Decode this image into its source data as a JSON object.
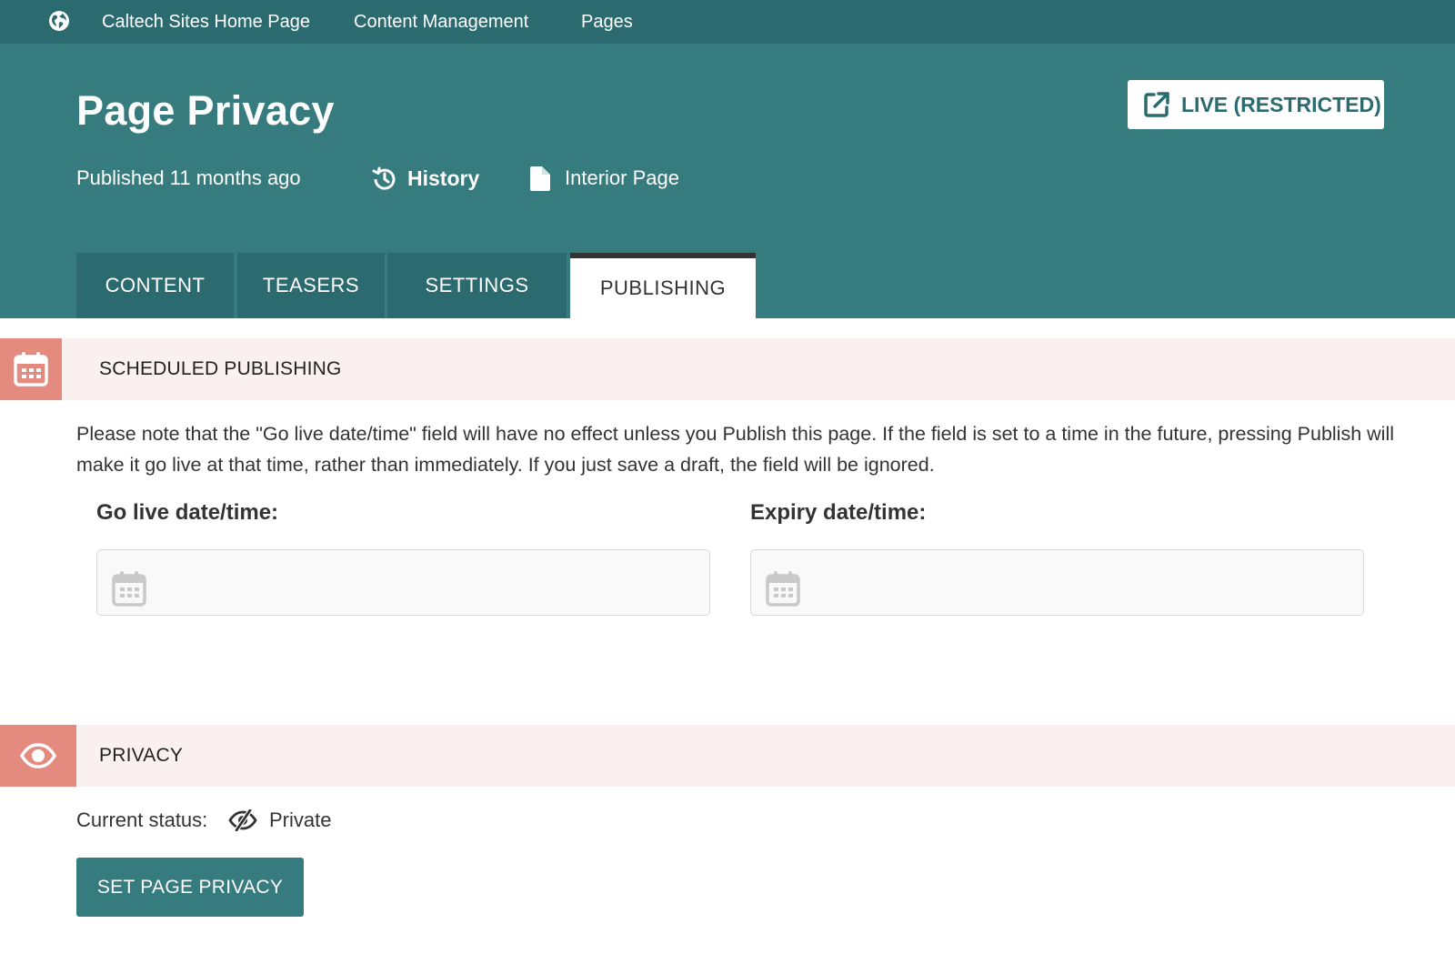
{
  "breadcrumb": {
    "home_icon": "globe-icon",
    "items": [
      "Caltech Sites Home Page",
      "Content Management",
      "Pages"
    ]
  },
  "header": {
    "title": "Page Privacy",
    "live_button": {
      "icon": "external-link-icon",
      "label": "LIVE (RESTRICTED)"
    },
    "published": "Published 11 months ago",
    "history": {
      "icon": "history-icon",
      "label": "History"
    },
    "page_type": {
      "icon": "document-icon",
      "label": "Interior Page"
    }
  },
  "tabs": [
    {
      "label": "CONTENT",
      "active": false
    },
    {
      "label": "TEASERS",
      "active": false
    },
    {
      "label": "SETTINGS",
      "active": false
    },
    {
      "label": "PUBLISHING",
      "active": true
    }
  ],
  "scheduled": {
    "icon": "calendar-icon",
    "title": "SCHEDULED PUBLISHING",
    "note": "Please note that the \"Go live date/time\" field will have no effect unless you Publish this page. If the field is set to a time in the future, pressing Publish will make it go live at that time, rather than immediately. If you just save a draft, the field will be ignored.",
    "go_live": {
      "label": "Go live date/time:",
      "value": ""
    },
    "expiry": {
      "label": "Expiry date/time:",
      "value": ""
    }
  },
  "privacy": {
    "icon": "eye-icon",
    "title": "PRIVACY",
    "status_label": "Current status:",
    "status_icon": "eye-slash-icon",
    "status_value": "Private",
    "button_label": "SET PAGE PRIVACY"
  },
  "colors": {
    "topbar": "#2b6a6e",
    "header": "#367b7e",
    "section_bg": "#fbf0f0",
    "section_icon": "#e48a7f"
  }
}
